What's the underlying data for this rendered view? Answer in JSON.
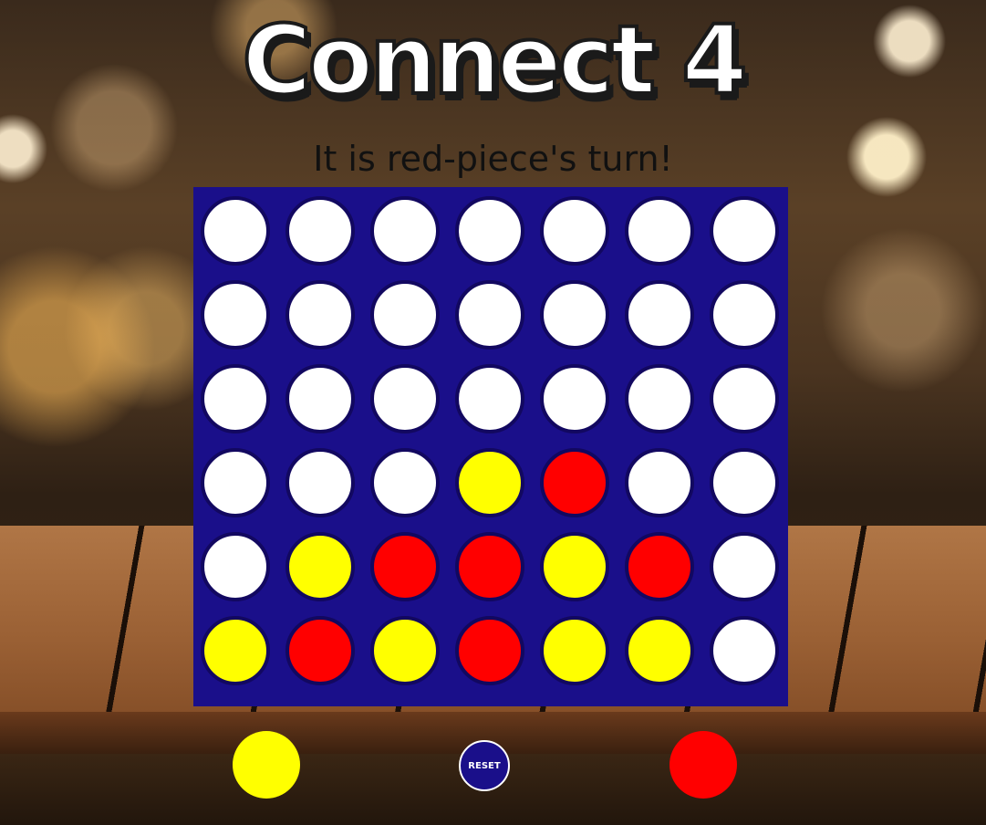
{
  "title": "Connect 4",
  "status": "It is red-piece's turn!",
  "colors": {
    "board": "#1a0f8a",
    "red": "#ff0000",
    "yellow": "#ffff00",
    "empty": "#ffffff"
  },
  "board": [
    [
      "empty",
      "empty",
      "empty",
      "empty",
      "empty",
      "empty",
      "empty"
    ],
    [
      "empty",
      "empty",
      "empty",
      "empty",
      "empty",
      "empty",
      "empty"
    ],
    [
      "empty",
      "empty",
      "empty",
      "empty",
      "empty",
      "empty",
      "empty"
    ],
    [
      "empty",
      "empty",
      "empty",
      "yellow",
      "red",
      "empty",
      "empty"
    ],
    [
      "empty",
      "yellow",
      "red",
      "red",
      "yellow",
      "red",
      "empty"
    ],
    [
      "yellow",
      "red",
      "yellow",
      "red",
      "yellow",
      "yellow",
      "empty"
    ]
  ],
  "reset_label": "RESET"
}
